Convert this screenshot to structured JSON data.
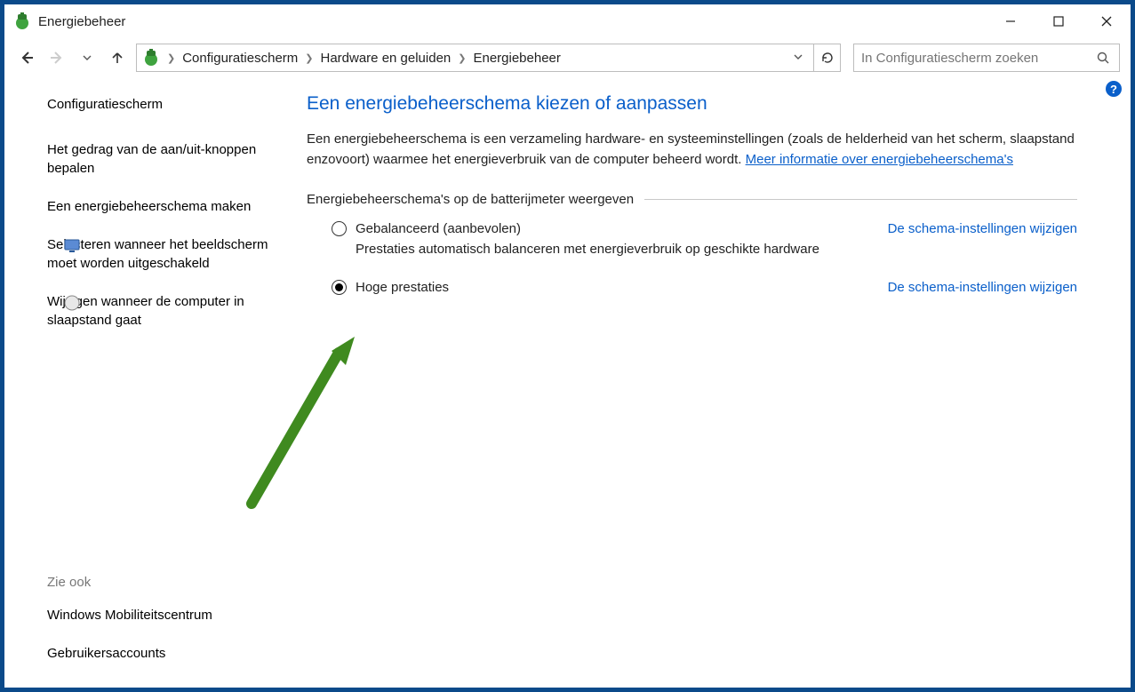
{
  "window": {
    "title": "Energiebeheer"
  },
  "breadcrumb": {
    "items": [
      "Configuratiescherm",
      "Hardware en geluiden",
      "Energiebeheer"
    ]
  },
  "search": {
    "placeholder": "In Configuratiescherm zoeken"
  },
  "sidebar": {
    "home": "Configuratiescherm",
    "links": [
      "Het gedrag van de aan/uit-knoppen bepalen",
      "Een energiebeheerschema maken",
      "Selecteren wanneer het beeldscherm moet worden uitgeschakeld",
      "Wijzigen wanneer de computer in slaapstand gaat"
    ],
    "see_also_label": "Zie ook",
    "see_also": [
      "Windows Mobiliteitscentrum",
      "Gebruikersaccounts"
    ]
  },
  "main": {
    "heading": "Een energiebeheerschema kiezen of aanpassen",
    "description": "Een energiebeheerschema is een verzameling hardware- en systeeminstellingen (zoals de helderheid van het scherm, slaapstand enzovoort) waarmee het energieverbruik van de computer beheerd wordt. ",
    "desc_link": "Meer informatie over energiebeheerschema's",
    "group_label": "Energiebeheerschema's op de batterijmeter weergeven",
    "plans": [
      {
        "name": "Gebalanceerd (aanbevolen)",
        "selected": false,
        "sub": "Prestaties automatisch balanceren met energieverbruik op geschikte hardware",
        "edit": "De schema-instellingen wijzigen"
      },
      {
        "name": "Hoge prestaties",
        "selected": true,
        "sub": "",
        "edit": "De schema-instellingen wijzigen"
      }
    ]
  },
  "help_badge": "?"
}
